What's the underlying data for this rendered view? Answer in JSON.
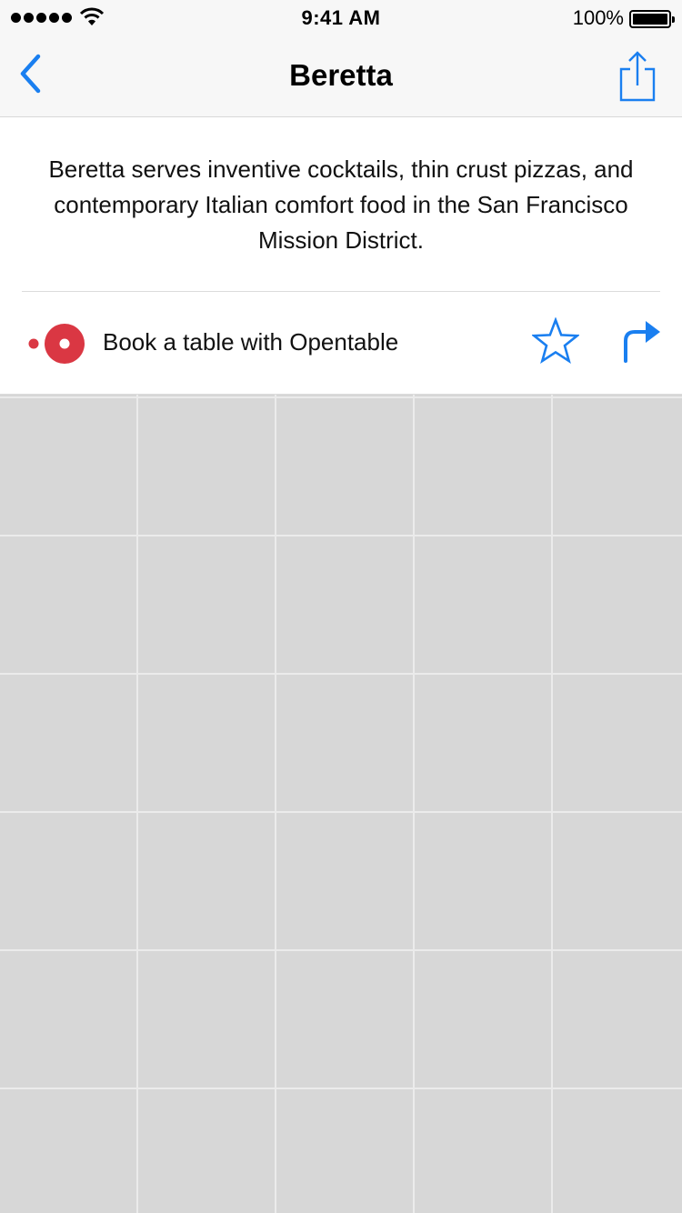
{
  "status_bar": {
    "time": "9:41 AM",
    "battery_percent": "100%",
    "signal_bars": 5
  },
  "nav": {
    "title": "Beretta",
    "back_icon": "chevron-left-icon",
    "share_icon": "share-icon"
  },
  "description": "Beretta serves inventive cocktails, thin crust pizzas, and contemporary Italian comfort food in the San Francisco Mission District.",
  "booking": {
    "label": "Book a table with Opentable",
    "logo_icon": "opentable-logo-icon",
    "favorite_icon": "star-icon",
    "directions_icon": "directions-icon"
  },
  "colors": {
    "accent": "#1a7ff0",
    "opentable_red": "#da3743",
    "map_tile": "#d7d7d7",
    "map_grid": "#ebebeb"
  },
  "map": {
    "type": "placeholder-tile-grid"
  }
}
